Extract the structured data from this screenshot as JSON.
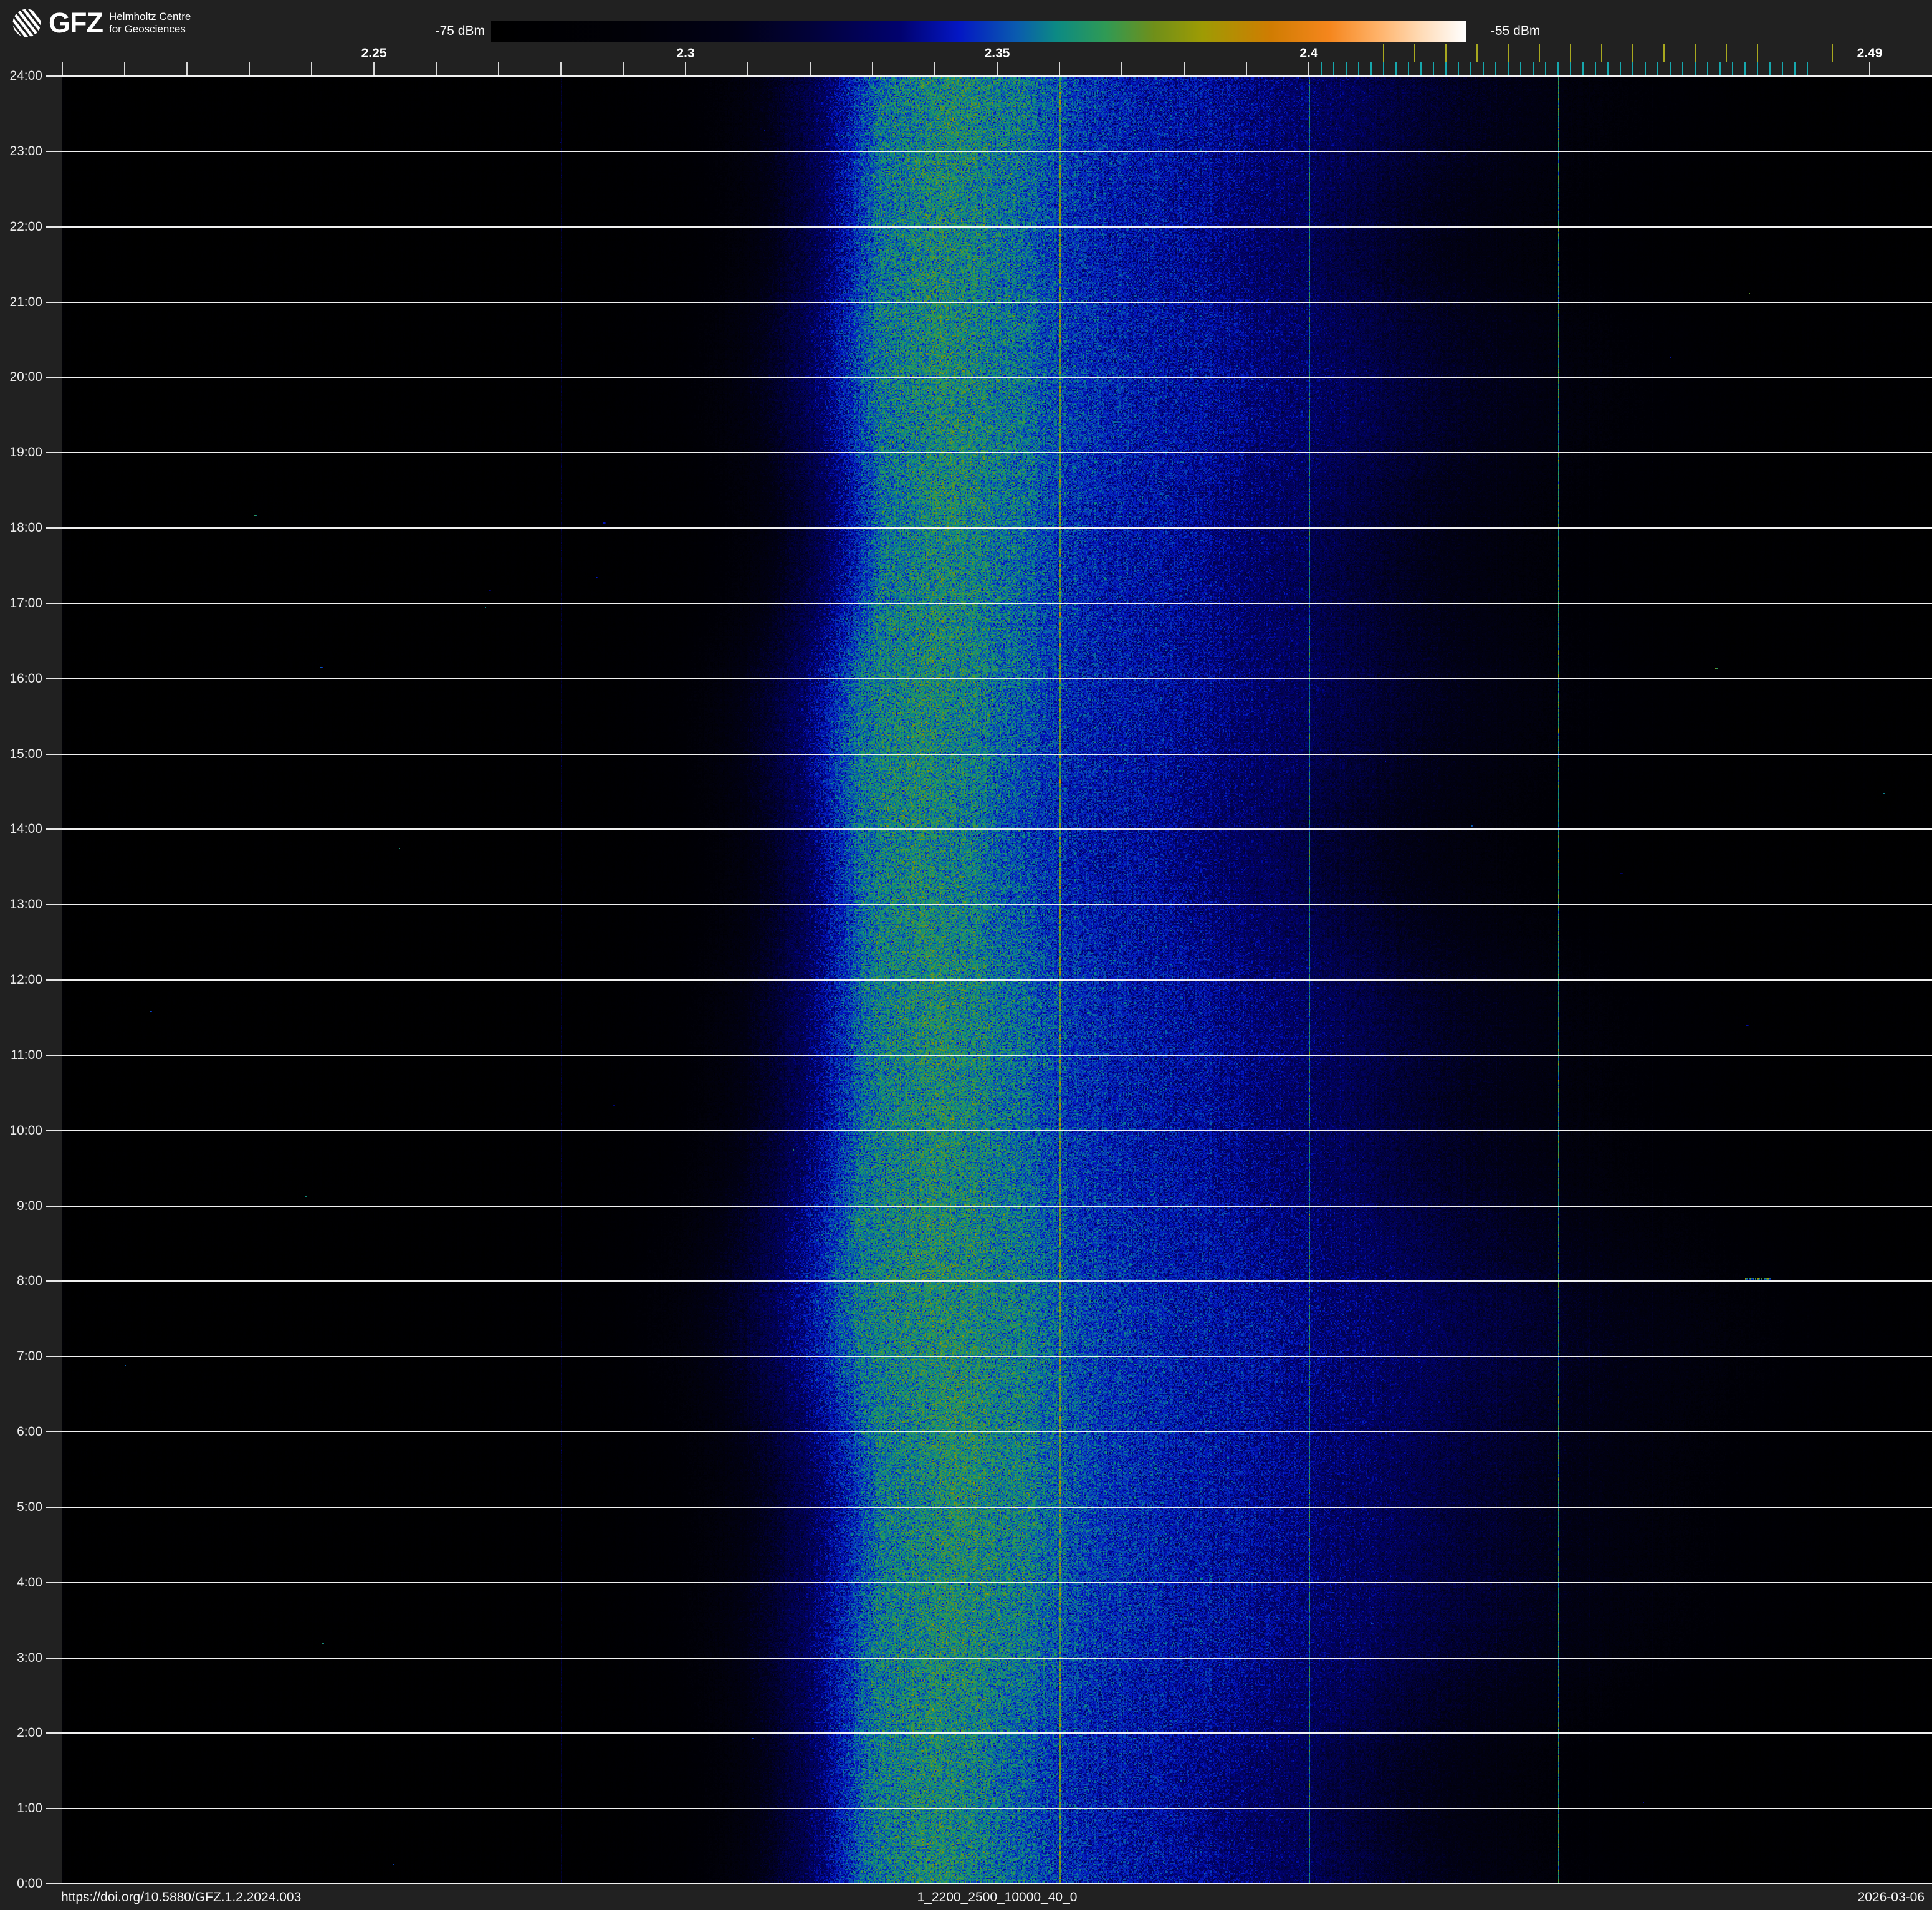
{
  "header": {
    "logo": {
      "brand": "GFZ",
      "line1": "Helmholtz Centre",
      "line2": "for Geosciences"
    },
    "colorbar": {
      "min_label": "-75 dBm",
      "max_label": "-55 dBm",
      "stops": [
        {
          "pos": 0.0,
          "color": "#000000"
        },
        {
          "pos": 0.15,
          "color": "#010108"
        },
        {
          "pos": 0.25,
          "color": "#010117"
        },
        {
          "pos": 0.33,
          "color": "#02023a"
        },
        {
          "pos": 0.42,
          "color": "#01026e"
        },
        {
          "pos": 0.48,
          "color": "#0417c4"
        },
        {
          "pos": 0.54,
          "color": "#0a5cae"
        },
        {
          "pos": 0.58,
          "color": "#0c8a84"
        },
        {
          "pos": 0.63,
          "color": "#2f9a55"
        },
        {
          "pos": 0.68,
          "color": "#6f8f1a"
        },
        {
          "pos": 0.73,
          "color": "#9e9b04"
        },
        {
          "pos": 0.8,
          "color": "#d07c02"
        },
        {
          "pos": 0.86,
          "color": "#f5861d"
        },
        {
          "pos": 0.91,
          "color": "#ffb269"
        },
        {
          "pos": 0.955,
          "color": "#ffdcb8"
        },
        {
          "pos": 1.0,
          "color": "#ffffff"
        }
      ]
    }
  },
  "axes": {
    "freq": {
      "range_ghz": [
        2.2,
        2.5
      ],
      "ticks_ghz": [
        2.2,
        2.21,
        2.22,
        2.23,
        2.24,
        2.25,
        2.26,
        2.27,
        2.28,
        2.29,
        2.3,
        2.31,
        2.32,
        2.33,
        2.34,
        2.35,
        2.36,
        2.37,
        2.38,
        2.39,
        2.4,
        2.41,
        2.42,
        2.43,
        2.44,
        2.45,
        2.46,
        2.47,
        2.48,
        2.49
      ],
      "labels": [
        {
          "value": 2.25,
          "text": "2.25"
        },
        {
          "value": 2.3,
          "text": "2.3"
        },
        {
          "value": 2.35,
          "text": "2.35"
        },
        {
          "value": 2.4,
          "text": "2.4"
        },
        {
          "value": 2.49,
          "text": "2.49"
        }
      ]
    },
    "time": {
      "entries": [
        {
          "hour": 24,
          "label": "24:00"
        },
        {
          "hour": 23,
          "label": "23:00"
        },
        {
          "hour": 22,
          "label": "22:00"
        },
        {
          "hour": 21,
          "label": "21:00"
        },
        {
          "hour": 20,
          "label": "20:00"
        },
        {
          "hour": 19,
          "label": "19:00"
        },
        {
          "hour": 18,
          "label": "18:00"
        },
        {
          "hour": 17,
          "label": "17:00"
        },
        {
          "hour": 16,
          "label": "16:00"
        },
        {
          "hour": 15,
          "label": "15:00"
        },
        {
          "hour": 14,
          "label": "14:00"
        },
        {
          "hour": 13,
          "label": "13:00"
        },
        {
          "hour": 12,
          "label": "12:00"
        },
        {
          "hour": 11,
          "label": "11:00"
        },
        {
          "hour": 10,
          "label": "10:00"
        },
        {
          "hour": 9,
          "label": "9:00"
        },
        {
          "hour": 8,
          "label": "8:00"
        },
        {
          "hour": 7,
          "label": "7:00"
        },
        {
          "hour": 6,
          "label": "6:00"
        },
        {
          "hour": 5,
          "label": "5:00"
        },
        {
          "hour": 4,
          "label": "4:00"
        },
        {
          "hour": 3,
          "label": "3:00"
        },
        {
          "hour": 2,
          "label": "2:00"
        },
        {
          "hour": 1,
          "label": "1:00"
        },
        {
          "hour": 0,
          "label": "0:00"
        }
      ]
    }
  },
  "footer": {
    "doi": "https://doi.org/10.5880/GFZ.1.2.2024.003",
    "dataset_id": "1_2200_2500_10000_40_0",
    "date": "2026-03-06"
  },
  "chart_data": {
    "type": "heatmap",
    "title": "1_2200_2500_10000_40_0",
    "xlabel": "",
    "ylabel": "",
    "x_range_ghz": [
      2.2,
      2.5
    ],
    "y_range_hours": [
      0,
      24
    ],
    "y_orientation": "0:00 at bottom, 24:00 at top",
    "grid": "hourly horizontal white lines",
    "color_scale": {
      "min_dbm": -75,
      "max_dbm": -55,
      "min_label": "-75 dBm",
      "max_label": "-55 dBm"
    },
    "spectral_profile": {
      "freq_ghz": [
        2.2,
        2.21,
        2.22,
        2.23,
        2.24,
        2.25,
        2.26,
        2.27,
        2.28,
        2.29,
        2.3,
        2.31,
        2.32,
        2.33,
        2.34,
        2.35,
        2.36,
        2.37,
        2.38,
        2.39,
        2.4,
        2.41,
        2.42,
        2.43,
        2.44,
        2.45,
        2.46,
        2.47,
        2.48,
        2.49,
        2.5
      ],
      "mean_level_dbm": [
        -74.6,
        -74.6,
        -74.6,
        -74.5,
        -74.5,
        -74.5,
        -74.4,
        -74.4,
        -74.2,
        -74.0,
        -73.2,
        -71.0,
        -67.5,
        -63.8,
        -63.0,
        -63.6,
        -64.9,
        -65.6,
        -66.0,
        -66.8,
        -67.4,
        -68.6,
        -69.8,
        -70.9,
        -71.9,
        -73.0,
        -73.8,
        -74.2,
        -74.1,
        -74.2,
        -74.4
      ]
    },
    "carriers": [
      {
        "freq_ghz": 2.28,
        "level_dbm": -68.8
      },
      {
        "freq_ghz": 2.36,
        "level_dbm": -61.6
      },
      {
        "freq_ghz": 2.4,
        "level_dbm": -63.4
      },
      {
        "freq_ghz": 2.44,
        "level_dbm": -63.2
      }
    ],
    "faint_traces_ghz": [
      2.24,
      2.25,
      2.405,
      2.43,
      2.445,
      2.455,
      2.465,
      2.48,
      2.489
    ],
    "wifi_channels_ghz": [
      2.412,
      2.417,
      2.422,
      2.427,
      2.432,
      2.437,
      2.442,
      2.447,
      2.452,
      2.457,
      2.462,
      2.467,
      2.472,
      2.484
    ],
    "ble_channels_ghz": [
      2.402,
      2.404,
      2.406,
      2.408,
      2.41,
      2.412,
      2.414,
      2.416,
      2.418,
      2.42,
      2.422,
      2.424,
      2.426,
      2.428,
      2.43,
      2.432,
      2.434,
      2.436,
      2.438,
      2.44,
      2.442,
      2.444,
      2.446,
      2.448,
      2.45,
      2.452,
      2.454,
      2.456,
      2.458,
      2.46,
      2.462,
      2.464,
      2.466,
      2.468,
      2.47,
      2.472,
      2.474,
      2.476,
      2.478,
      2.48
    ],
    "events": [
      {
        "type": "burst",
        "freq_start_ghz": 2.47,
        "freq_end_ghz": 2.474,
        "hour": 8.05,
        "level_dbm": -62
      },
      {
        "type": "spot",
        "freq_ghz": 2.426,
        "hour": 14.05,
        "level_dbm": -64
      }
    ]
  }
}
